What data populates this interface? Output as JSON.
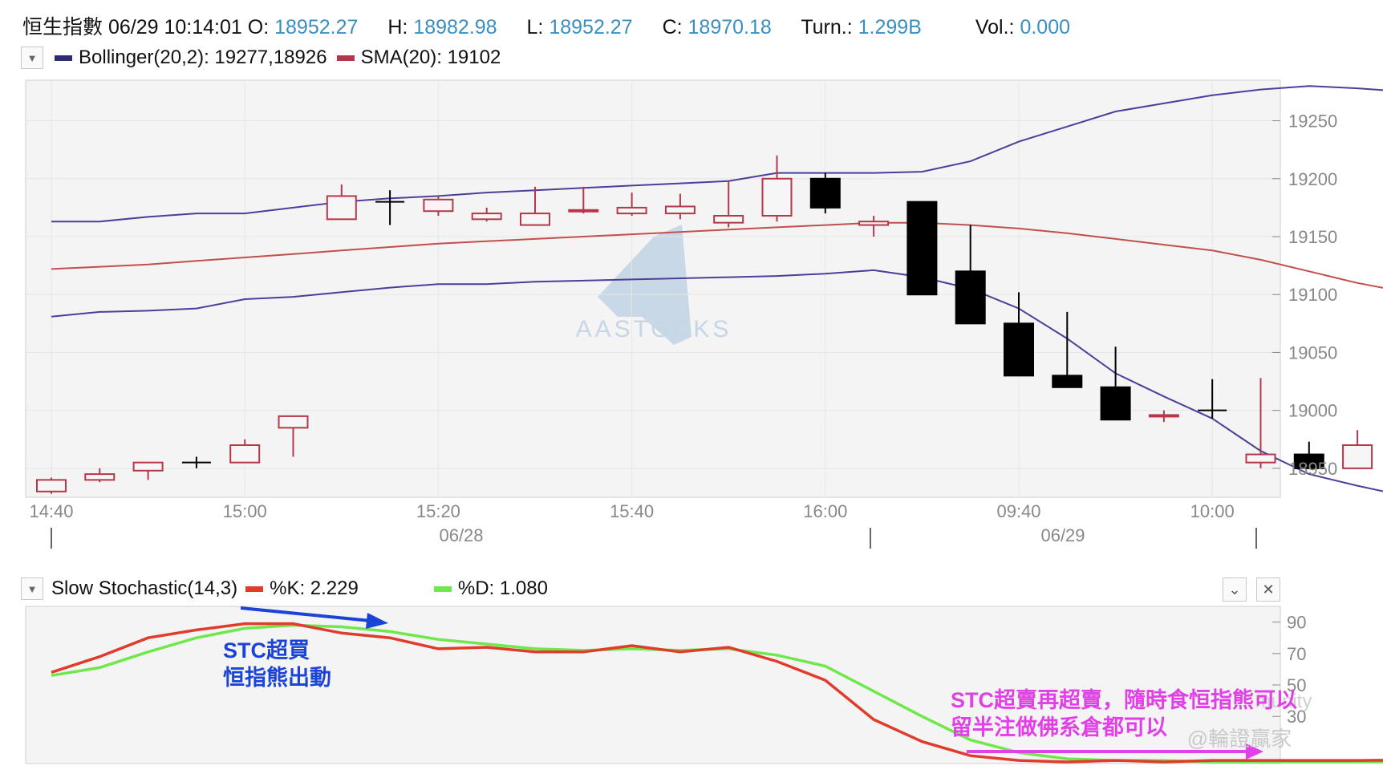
{
  "quote": {
    "name": "恒生指數",
    "datetime": "06/29 10:14:01",
    "open_label": "O:",
    "open": "18952.27",
    "high_label": "H:",
    "high": "18982.98",
    "low_label": "L:",
    "low": "18952.27",
    "close_label": "C:",
    "close": "18970.18",
    "turn_label": "Turn.:",
    "turn": "1.299B",
    "vol_label": "Vol.:",
    "vol": "0.000"
  },
  "main_legend": {
    "boll": "Bollinger(20,2): 19277,18926",
    "sma": "SMA(20): 19102"
  },
  "stoch_legend": {
    "title": "Slow Stochastic(14,3)",
    "k": "%K: 2.229",
    "d": "%D: 1.080"
  },
  "watermark": "AASTOCKS",
  "date_labels": [
    "06/28",
    "06/29"
  ],
  "annotations": {
    "blue": [
      "STC超買",
      "恒指熊出動"
    ],
    "pink": [
      "STC超賣再超賣，隨時食恒指熊可以",
      "留半注做佛系倉都可以"
    ],
    "credit": "@輪證贏家",
    "faint": "munity"
  },
  "colors": {
    "upper_band": "#4a3f9a",
    "lower_band": "#4a3f9a",
    "sma": "#c0504d",
    "up_candle": "#b5374a",
    "down_candle": "#000000",
    "k_line": "#e03c2c",
    "d_line": "#6ee84a",
    "value_text": "#3b8fc0",
    "blue_note": "#1b43d6",
    "pink_note": "#e040e6"
  },
  "icons": [
    "chevron-down-icon",
    "close-icon"
  ],
  "chart_data": [
    {
      "type": "candlestick",
      "title": "恒生指數",
      "x": [
        "14:40",
        "14:45",
        "14:50",
        "14:55",
        "15:00",
        "15:05",
        "15:10",
        "15:15",
        "15:20",
        "15:25",
        "15:30",
        "15:35",
        "15:40",
        "15:45",
        "15:50",
        "15:55",
        "16:00",
        "16:05",
        "09:30",
        "09:35",
        "09:40",
        "09:45",
        "09:50",
        "09:55",
        "10:00",
        "10:05",
        "10:10",
        "10:15",
        "10:20"
      ],
      "x_tick_labels": [
        "14:40",
        "15:00",
        "15:20",
        "15:40",
        "16:00",
        "09:40",
        "10:00"
      ],
      "open": [
        18930,
        18940,
        18948,
        18955,
        18955,
        18985,
        19165,
        19180,
        19172,
        19165,
        19160,
        19172,
        19170,
        19170,
        19162,
        19168,
        19200,
        19160,
        19180,
        19120,
        19075,
        19030,
        19020,
        18995,
        19000,
        18955,
        18962,
        18950,
        18968
      ],
      "high": [
        18942,
        18950,
        18955,
        18960,
        18975,
        18995,
        19195,
        19190,
        19185,
        19175,
        19193,
        19193,
        19188,
        19187,
        19198,
        19220,
        19205,
        19168,
        19180,
        19160,
        19102,
        19085,
        19055,
        19000,
        19027,
        19028,
        18973,
        18983,
        18984
      ],
      "low": [
        18928,
        18938,
        18940,
        18950,
        18955,
        18960,
        19165,
        19160,
        19168,
        19163,
        19160,
        19170,
        19168,
        19165,
        19158,
        19163,
        19170,
        19150,
        19100,
        19075,
        19030,
        19020,
        18992,
        18990,
        18993,
        18950,
        18950,
        18950,
        18950
      ],
      "close": [
        18940,
        18945,
        18955,
        18955,
        18970,
        18995,
        19185,
        19180,
        19182,
        19170,
        19170,
        19173,
        19175,
        19176,
        19168,
        19200,
        19175,
        19163,
        19100,
        19075,
        19030,
        19020,
        18992,
        18996,
        19000,
        18962,
        18950,
        18970,
        18955
      ],
      "upper_band": [
        19163,
        19163,
        19167,
        19170,
        19170,
        19175,
        19180,
        19183,
        19185,
        19188,
        19190,
        19192,
        19194,
        19196,
        19198,
        19205,
        19205,
        19205,
        19206,
        19215,
        19232,
        19245,
        19258,
        19265,
        19272,
        19277,
        19280,
        19278,
        19275
      ],
      "sma": [
        19122,
        19124,
        19126,
        19129,
        19132,
        19135,
        19138,
        19141,
        19144,
        19146,
        19148,
        19150,
        19152,
        19154,
        19156,
        19158,
        19160,
        19162,
        19162,
        19160,
        19157,
        19153,
        19148,
        19143,
        19138,
        19130,
        19120,
        19110,
        19102
      ],
      "lower_band": [
        19081,
        19085,
        19086,
        19088,
        19096,
        19098,
        19102,
        19106,
        19109,
        19109,
        19111,
        19112,
        19113,
        19114,
        19115,
        19116,
        19118,
        19121,
        19115,
        19105,
        19088,
        19062,
        19032,
        19012,
        18993,
        18965,
        18945,
        18935,
        18926
      ],
      "ylim": [
        18925,
        19285
      ],
      "y_ticks": [
        18950,
        19000,
        19050,
        19100,
        19150,
        19200,
        19250
      ]
    },
    {
      "type": "line",
      "title": "Slow Stochastic(14,3)",
      "x": [
        "14:40",
        "14:45",
        "14:50",
        "14:55",
        "15:00",
        "15:05",
        "15:10",
        "15:15",
        "15:20",
        "15:25",
        "15:30",
        "15:35",
        "15:40",
        "15:45",
        "15:50",
        "15:55",
        "16:00",
        "16:05",
        "09:30",
        "09:35",
        "09:40",
        "09:45",
        "09:50",
        "09:55",
        "10:00",
        "10:05",
        "10:10",
        "10:15",
        "10:20"
      ],
      "series": [
        {
          "name": "%K",
          "values": [
            58,
            68,
            80,
            85,
            89,
            89,
            83,
            80,
            73,
            74,
            71,
            71,
            75,
            71,
            74,
            65,
            53,
            28,
            14,
            5,
            2,
            1,
            2,
            1,
            2,
            2,
            2,
            2,
            2.229
          ]
        },
        {
          "name": "%D",
          "values": [
            56,
            61,
            71,
            80,
            86,
            88,
            87,
            84,
            79,
            76,
            73,
            72,
            73,
            72,
            73,
            69,
            62,
            46,
            30,
            15,
            7,
            3,
            2,
            2,
            1,
            1,
            1,
            1,
            1.08
          ]
        }
      ],
      "ylim": [
        0,
        100
      ],
      "y_ticks": [
        30,
        50,
        70,
        90
      ]
    }
  ]
}
